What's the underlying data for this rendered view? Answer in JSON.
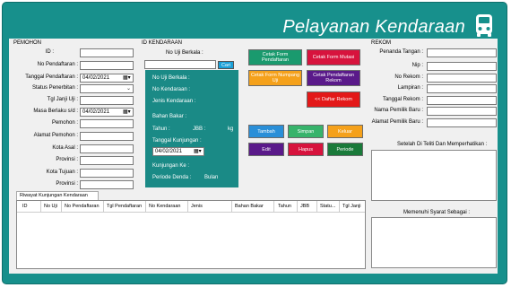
{
  "app": {
    "title": "Pelayanan Kendaraan",
    "icon": "vehicle-icon"
  },
  "pemohon": {
    "group_label": "PEMOHON",
    "fields": [
      {
        "label": "ID :",
        "value": ""
      },
      {
        "label": "No Pendaftaran :",
        "value": ""
      },
      {
        "label": "Tanggal Pendaftaran :",
        "value": "04/02/2021"
      },
      {
        "label": "Status Penerbitan :",
        "value": ""
      },
      {
        "label": "Tgl Janji Uji :",
        "value": ""
      },
      {
        "label": "Masa Berlaku s/d :",
        "value": "04/02/2021"
      },
      {
        "label": "Pemohon :",
        "value": ""
      },
      {
        "label": "Alamat Pemohon :",
        "value": ""
      },
      {
        "label": "Kota Asal :",
        "value": ""
      },
      {
        "label": "Provinsi :",
        "value": ""
      },
      {
        "label": "Kota Tujuan :",
        "value": ""
      },
      {
        "label": "Provinsi :",
        "value": ""
      }
    ]
  },
  "kendaraan": {
    "group_label": "ID KENDARAAN",
    "search_label": "No Uji Berkala :",
    "search_value": "",
    "search_button": "Cari",
    "info": {
      "no_uji": "No Uji Berkala :",
      "no_kendaraan": "No Kendaraan :",
      "jenis": "Jenis Kendaraan :",
      "bahan_bakar": "Bahan Bakar :",
      "tahun": "Tahun :",
      "jbb": "JBB :",
      "kg": "kg",
      "tgl_kunjungan": "Tanggal Kunjungan :",
      "tgl_kunjungan_value": "04/02/2021",
      "kunjungan_ke": "Kunjungan Ke :",
      "periode_denda": "Periode Denda :",
      "bulan": "Bulan"
    }
  },
  "actions": {
    "cetak_pendaftaran": {
      "label": "Cetak Form Pendaftaran",
      "color": "#1a9a6e"
    },
    "cetak_mutasi": {
      "label": "Cetak Form Mutasi",
      "color": "#d7133d"
    },
    "cetak_numpang": {
      "label": "Cetak Form Numpang Uji",
      "color": "#f5a11b"
    },
    "cetak_rekom": {
      "label": "Cetak Pendaftaran Rekom",
      "color": "#5a1a8a"
    },
    "daftar_rekom": {
      "label": "<< Daftar Rekom",
      "color": "#e31818"
    },
    "tambah": {
      "label": "Tambah",
      "color": "#2a8fd8"
    },
    "simpan": {
      "label": "Simpan",
      "color": "#37b36b"
    },
    "keluar": {
      "label": "Keluar",
      "color": "#f5a11b"
    },
    "edit": {
      "label": "Edit",
      "color": "#5a1a8a"
    },
    "hapus": {
      "label": "Hapus",
      "color": "#d7133d"
    },
    "periode": {
      "label": "Periode",
      "color": "#1a7a3a"
    }
  },
  "rekom": {
    "group_label": "REKOM",
    "fields": [
      {
        "label": "Penanda Tangan :",
        "value": ""
      },
      {
        "label": "Nip :",
        "value": ""
      },
      {
        "label": "No Rekom :",
        "value": ""
      },
      {
        "label": "Lampiran :",
        "value": ""
      },
      {
        "label": "Tanggal Rekom :",
        "value": ""
      },
      {
        "label": "Nama Pemilik Baru :",
        "value": ""
      },
      {
        "label": "Alamat Pemilik Baru :",
        "value": ""
      }
    ],
    "notes1_label": "Setelah Di Teliti Dan Memperhatikan :",
    "notes2_label": "Memenuhi Syarat Sebagai :"
  },
  "riwayat": {
    "tab_label": "Riwayat Kunjungan Kendaraan",
    "columns": [
      "ID",
      "No Uji",
      "No Pendaftaran",
      "Tgl Pendaftaran",
      "No Kendaraan",
      "Jenis",
      "Bahan Bakar",
      "Tahun",
      "JBB",
      "Statu...",
      "Tgl Janji"
    ]
  }
}
